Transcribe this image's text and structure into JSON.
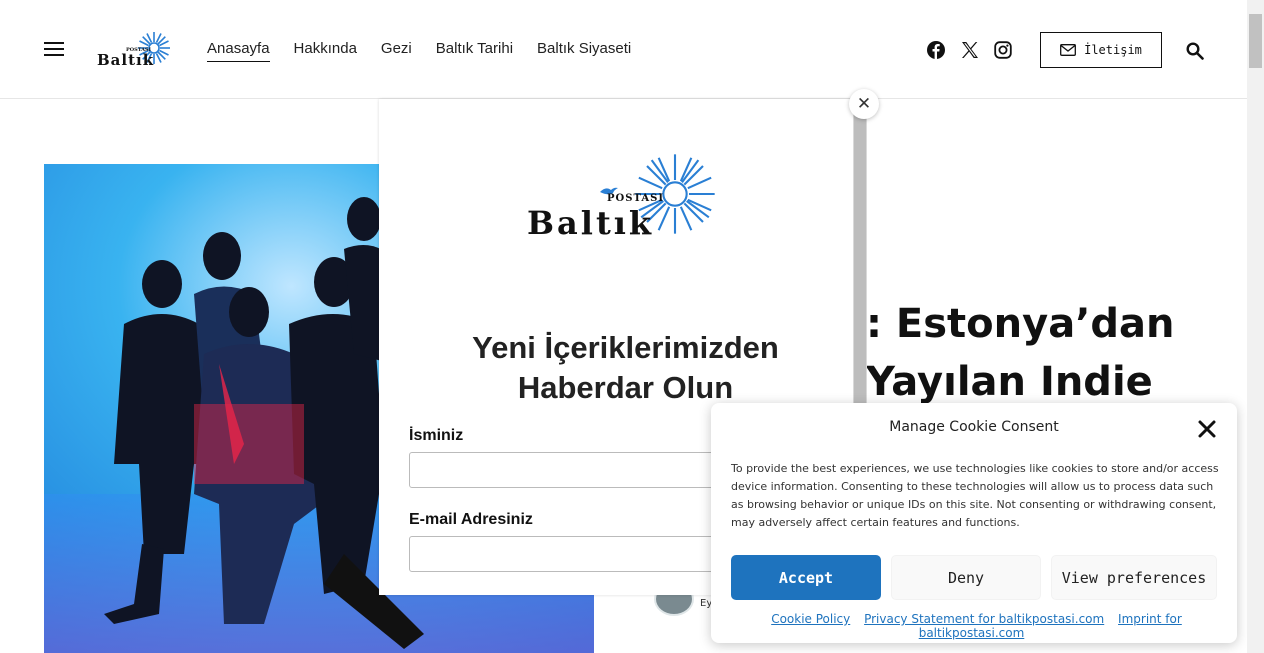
{
  "header": {
    "logo": {
      "word": "Baltık",
      "sub": "POSTASI"
    },
    "nav": [
      "Anasayfa",
      "Hakkında",
      "Gezi",
      "Baltık Tarihi",
      "Baltık Siyaseti"
    ],
    "social_icons": [
      "facebook-icon",
      "x-twitter-icon",
      "instagram-icon"
    ],
    "contact_label": "İletişim"
  },
  "article": {
    "title_lines": [
      ": Estonya’dan",
      "Yayılan Indie"
    ],
    "author_meta": "Ey"
  },
  "newsletter": {
    "logo": {
      "word": "Baltık",
      "sub": "POSTASI"
    },
    "heading_line1": "Yeni İçeriklerimizden",
    "heading_line2": "Haberdar Olun",
    "name_label": "İsminiz",
    "email_label": "E-mail Adresiniz",
    "close_symbol": "✕"
  },
  "cookie": {
    "title": "Manage Cookie Consent",
    "text": "To provide the best experiences, we use technologies like cookies to store and/or access device information. Consenting to these technologies will allow us to process data such as browsing behavior or unique IDs on this site. Not consenting or withdrawing consent, may adversely affect certain features and functions.",
    "accept": "Accept",
    "deny": "Deny",
    "preferences": "View preferences",
    "links": [
      "Cookie Policy",
      "Privacy Statement for baltikpostasi.com",
      "Imprint for baltikpostasi.com"
    ]
  },
  "colors": {
    "accent": "#1e73be",
    "logo_blue": "#2a7fd4"
  }
}
